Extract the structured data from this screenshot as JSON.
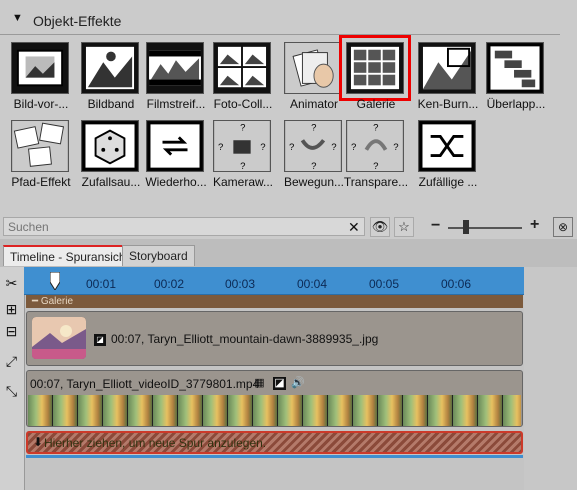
{
  "effects_panel": {
    "section_title": "Objekt-Effekte",
    "tiles": [
      {
        "label": "Bild-vor-...",
        "icon": "picture-in-picture-icon"
      },
      {
        "label": "Bildband",
        "icon": "filmstrip-picture-icon"
      },
      {
        "label": "Filmstreif...",
        "icon": "film-reel-icon"
      },
      {
        "label": "Foto-Coll...",
        "icon": "photo-collage-icon"
      },
      {
        "label": "Animator",
        "icon": "hand-stack-icon"
      },
      {
        "label": "Galerie",
        "icon": "gallery-grid-icon",
        "selected": true
      },
      {
        "label": "Ken-Burn...",
        "icon": "ken-burns-icon"
      },
      {
        "label": "Überlapp...",
        "icon": "overlap-steps-icon"
      },
      {
        "label": "Pfad-Effekt",
        "icon": "photo-path-icon"
      },
      {
        "label": "Zufallsau...",
        "icon": "dice-icon"
      },
      {
        "label": "Wiederho...",
        "icon": "repeat-icon"
      },
      {
        "label": "Kameraw...",
        "icon": "camera-move-icon"
      },
      {
        "label": "Bewegun...",
        "icon": "motion-path-icon"
      },
      {
        "label": "Transpare...",
        "icon": "transparency-icon"
      },
      {
        "label": "Zufällige ...",
        "icon": "shuffle-icon"
      }
    ],
    "search": {
      "placeholder": "Suchen"
    }
  },
  "tabs": [
    {
      "label": "Timeline - Spuransicht",
      "active": true
    },
    {
      "label": "Storyboard",
      "active": false
    }
  ],
  "timeline": {
    "ruler_ticks": [
      "00:01",
      "00:02",
      "00:03",
      "00:04",
      "00:05",
      "00:06"
    ],
    "group_label": "Galerie",
    "image_track_label": "00:07, Taryn_Elliott_mountain-dawn-3889935_.jpg",
    "video_track_label": "00:07, Taryn_Elliott_videoID_3779801.mp4",
    "new_track_hint": "Hierher ziehen, um neue Spur anzulegen."
  },
  "colors": {
    "selection": "#e00000",
    "ruler": "#3f8fd0",
    "group_header": "#7c5a3c",
    "hint_border": "#cc3a2a"
  }
}
